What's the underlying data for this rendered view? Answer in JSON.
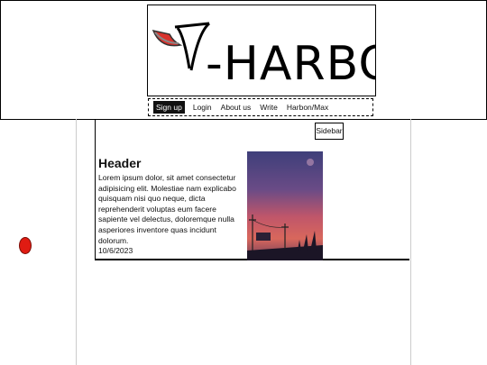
{
  "header": {
    "logo_text": "-HARBON"
  },
  "nav": {
    "items": [
      "Sign up",
      "Login",
      "About us",
      "Write",
      "Harbon/Max"
    ]
  },
  "sidebar": {
    "label": "Sidebar"
  },
  "post": {
    "title": "Header",
    "body": "Lorem ipsum dolor, sit amet consectetur adipisicing elit. Molestiae nam explicabo quisquam nisi quo neque, dicta reprehenderit voluptas eum facere sapiente vel delectus, doloremque nulla asperiores inventore quas incidunt dolorum.",
    "date": "10/6/2023"
  },
  "colors": {
    "accent_red": "#e01b12",
    "nav_active_bg": "#111111"
  }
}
